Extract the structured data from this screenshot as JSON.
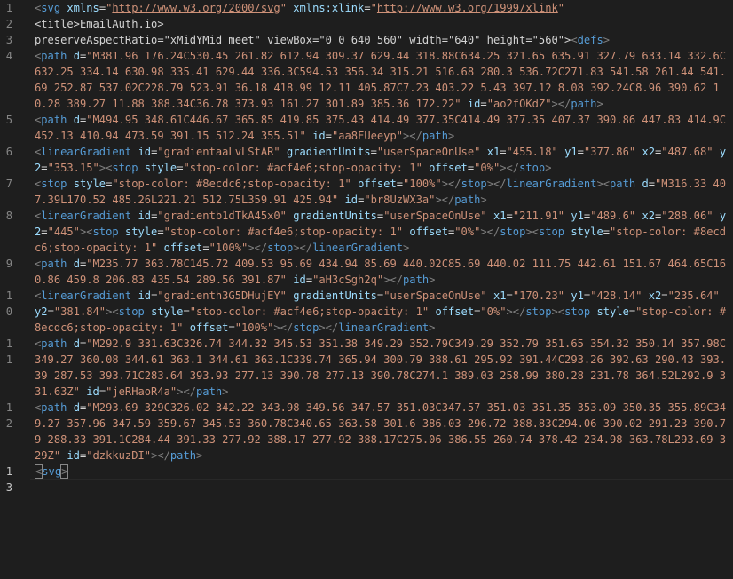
{
  "editor": {
    "language": "svg",
    "current_line": 13,
    "lines": [
      {
        "n": 1,
        "tokens": [
          [
            "brk",
            "<"
          ],
          [
            "tag",
            "svg"
          ],
          [
            "txt",
            " "
          ],
          [
            "attr",
            "xmlns"
          ],
          [
            "eq",
            "="
          ],
          [
            "str",
            "\""
          ],
          [
            "url",
            "http://www.w3.org/2000/svg"
          ],
          [
            "str",
            "\""
          ],
          [
            "txt",
            " "
          ],
          [
            "attr",
            "xmlns:xlink"
          ],
          [
            "eq",
            "="
          ],
          [
            "str",
            "\""
          ],
          [
            "url",
            "http://www.w3.org/1999/xlink"
          ],
          [
            "str",
            "\""
          ]
        ]
      },
      {
        "n": 2,
        "tokens": [
          [
            "txt",
            "<title>EmailAuth.io>"
          ]
        ]
      },
      {
        "n": 3,
        "tokens": [
          [
            "txt",
            "preserveAspectRatio=\"xMidYMid meet\" viewBox=\"0 0 640 560\" width=\"640\" height=\"560\">"
          ],
          [
            "brk",
            "<"
          ],
          [
            "tag",
            "defs"
          ],
          [
            "brk",
            ">"
          ]
        ]
      },
      {
        "n": 4,
        "tokens": [
          [
            "brk",
            "<"
          ],
          [
            "tag",
            "path"
          ],
          [
            "txt",
            " "
          ],
          [
            "attr",
            "d"
          ],
          [
            "eq",
            "="
          ],
          [
            "str",
            "\"M381.96 176.24C530.45 261.82 612.94 309.37 629.44 318.88C634.25 321.65 635.91 327.79 633.14 332.6C632.25 334.14 630.98 335.41 629.44 336.3C594.53 356.34 315.21 516.68 280.3 536.72C271.83 541.58 261.44 541.69 252.87 537.02C228.79 523.91 36.18 418.99 12.11 405.87C7.23 403.22 5.43 397.12 8.08 392.24C8.96 390.62 10.28 389.27 11.88 388.34C36.78 373.93 161.27 301.89 385.36 172.22\""
          ],
          [
            "txt",
            " "
          ],
          [
            "attr",
            "id"
          ],
          [
            "eq",
            "="
          ],
          [
            "str",
            "\"ao2fOKdZ\""
          ],
          [
            "brk",
            "></"
          ],
          [
            "tag",
            "path"
          ],
          [
            "brk",
            ">"
          ]
        ]
      },
      {
        "n": 5,
        "tokens": [
          [
            "brk",
            "<"
          ],
          [
            "tag",
            "path"
          ],
          [
            "txt",
            " "
          ],
          [
            "attr",
            "d"
          ],
          [
            "eq",
            "="
          ],
          [
            "str",
            "\"M494.95 348.61C446.67 365.85 419.85 375.43 414.49 377.35C414.49 377.35 407.37 390.86 447.83 414.9C452.13 410.94 473.59 391.15 512.24 355.51\""
          ],
          [
            "txt",
            " "
          ],
          [
            "attr",
            "id"
          ],
          [
            "eq",
            "="
          ],
          [
            "str",
            "\"aa8FUeeyp\""
          ],
          [
            "brk",
            "></"
          ],
          [
            "tag",
            "path"
          ],
          [
            "brk",
            ">"
          ]
        ]
      },
      {
        "n": 6,
        "tokens": [
          [
            "brk",
            "<"
          ],
          [
            "tag",
            "linearGradient"
          ],
          [
            "txt",
            " "
          ],
          [
            "attr",
            "id"
          ],
          [
            "eq",
            "="
          ],
          [
            "str",
            "\"gradientaaLvLStAR\""
          ],
          [
            "txt",
            " "
          ],
          [
            "attr",
            "gradientUnits"
          ],
          [
            "eq",
            "="
          ],
          [
            "str",
            "\"userSpaceOnUse\""
          ],
          [
            "txt",
            " "
          ],
          [
            "attr",
            "x1"
          ],
          [
            "eq",
            "="
          ],
          [
            "str",
            "\"455.18\""
          ],
          [
            "txt",
            " "
          ],
          [
            "attr",
            "y1"
          ],
          [
            "eq",
            "="
          ],
          [
            "str",
            "\"377.86\""
          ],
          [
            "txt",
            " "
          ],
          [
            "attr",
            "x2"
          ],
          [
            "eq",
            "="
          ],
          [
            "str",
            "\"487.68\""
          ],
          [
            "txt",
            " "
          ],
          [
            "attr",
            "y2"
          ],
          [
            "eq",
            "="
          ],
          [
            "str",
            "\"353.15\""
          ],
          [
            "brk",
            "><"
          ],
          [
            "tag",
            "stop"
          ],
          [
            "txt",
            " "
          ],
          [
            "attr",
            "style"
          ],
          [
            "eq",
            "="
          ],
          [
            "str",
            "\"stop-color: #acf4e6;stop-opacity: 1\""
          ],
          [
            "txt",
            " "
          ],
          [
            "attr",
            "offset"
          ],
          [
            "eq",
            "="
          ],
          [
            "str",
            "\"0%\""
          ],
          [
            "brk",
            "></"
          ],
          [
            "tag",
            "stop"
          ],
          [
            "brk",
            ">"
          ]
        ]
      },
      {
        "n": 7,
        "tokens": [
          [
            "brk",
            "<"
          ],
          [
            "tag",
            "stop"
          ],
          [
            "txt",
            " "
          ],
          [
            "attr",
            "style"
          ],
          [
            "eq",
            "="
          ],
          [
            "str",
            "\"stop-color: #8ecdc6;stop-opacity: 1\""
          ],
          [
            "txt",
            " "
          ],
          [
            "attr",
            "offset"
          ],
          [
            "eq",
            "="
          ],
          [
            "str",
            "\"100%\""
          ],
          [
            "brk",
            "></"
          ],
          [
            "tag",
            "stop"
          ],
          [
            "brk",
            "></"
          ],
          [
            "tag",
            "linearGradient"
          ],
          [
            "brk",
            "><"
          ],
          [
            "tag",
            "path"
          ],
          [
            "txt",
            " "
          ],
          [
            "attr",
            "d"
          ],
          [
            "eq",
            "="
          ],
          [
            "str",
            "\"M316.33 407.39L170.52 485.26L221.21 512.75L359.91 425.94\""
          ],
          [
            "txt",
            " "
          ],
          [
            "attr",
            "id"
          ],
          [
            "eq",
            "="
          ],
          [
            "str",
            "\"br8UzWX3a\""
          ],
          [
            "brk",
            "></"
          ],
          [
            "tag",
            "path"
          ],
          [
            "brk",
            ">"
          ]
        ]
      },
      {
        "n": 8,
        "tokens": [
          [
            "brk",
            "<"
          ],
          [
            "tag",
            "linearGradient"
          ],
          [
            "txt",
            " "
          ],
          [
            "attr",
            "id"
          ],
          [
            "eq",
            "="
          ],
          [
            "str",
            "\"gradientb1dTkA45x0\""
          ],
          [
            "txt",
            " "
          ],
          [
            "attr",
            "gradientUnits"
          ],
          [
            "eq",
            "="
          ],
          [
            "str",
            "\"userSpaceOnUse\""
          ],
          [
            "txt",
            " "
          ],
          [
            "attr",
            "x1"
          ],
          [
            "eq",
            "="
          ],
          [
            "str",
            "\"211.91\""
          ],
          [
            "txt",
            " "
          ],
          [
            "attr",
            "y1"
          ],
          [
            "eq",
            "="
          ],
          [
            "str",
            "\"489.6\""
          ],
          [
            "txt",
            " "
          ],
          [
            "attr",
            "x2"
          ],
          [
            "eq",
            "="
          ],
          [
            "str",
            "\"288.06\""
          ],
          [
            "txt",
            " "
          ],
          [
            "attr",
            "y2"
          ],
          [
            "eq",
            "="
          ],
          [
            "str",
            "\"445\""
          ],
          [
            "brk",
            "><"
          ],
          [
            "tag",
            "stop"
          ],
          [
            "txt",
            " "
          ],
          [
            "attr",
            "style"
          ],
          [
            "eq",
            "="
          ],
          [
            "str",
            "\"stop-color: #acf4e6;stop-opacity: 1\""
          ],
          [
            "txt",
            " "
          ],
          [
            "attr",
            "offset"
          ],
          [
            "eq",
            "="
          ],
          [
            "str",
            "\"0%\""
          ],
          [
            "brk",
            "></"
          ],
          [
            "tag",
            "stop"
          ],
          [
            "brk",
            "><"
          ],
          [
            "tag",
            "stop"
          ],
          [
            "txt",
            " "
          ],
          [
            "attr",
            "style"
          ],
          [
            "eq",
            "="
          ],
          [
            "str",
            "\"stop-color: #8ecdc6;stop-opacity: 1\""
          ],
          [
            "txt",
            " "
          ],
          [
            "attr",
            "offset"
          ],
          [
            "eq",
            "="
          ],
          [
            "str",
            "\"100%\""
          ],
          [
            "brk",
            "></"
          ],
          [
            "tag",
            "stop"
          ],
          [
            "brk",
            "></"
          ],
          [
            "tag",
            "linearGradient"
          ],
          [
            "brk",
            ">"
          ]
        ]
      },
      {
        "n": 9,
        "tokens": [
          [
            "brk",
            "<"
          ],
          [
            "tag",
            "path"
          ],
          [
            "txt",
            " "
          ],
          [
            "attr",
            "d"
          ],
          [
            "eq",
            "="
          ],
          [
            "str",
            "\"M235.77 363.78C145.72 409.53 95.69 434.94 85.69 440.02C85.69 440.02 111.75 442.61 151.67 464.65C160.86 459.8 206.83 435.54 289.56 391.87\""
          ],
          [
            "txt",
            " "
          ],
          [
            "attr",
            "id"
          ],
          [
            "eq",
            "="
          ],
          [
            "str",
            "\"aH3cSgh2q\""
          ],
          [
            "brk",
            "></"
          ],
          [
            "tag",
            "path"
          ],
          [
            "brk",
            ">"
          ]
        ]
      },
      {
        "n": 10,
        "tokens": [
          [
            "brk",
            "<"
          ],
          [
            "tag",
            "linearGradient"
          ],
          [
            "txt",
            " "
          ],
          [
            "attr",
            "id"
          ],
          [
            "eq",
            "="
          ],
          [
            "str",
            "\"gradienth3G5DHujEY\""
          ],
          [
            "txt",
            " "
          ],
          [
            "attr",
            "gradientUnits"
          ],
          [
            "eq",
            "="
          ],
          [
            "str",
            "\"userSpaceOnUse\""
          ],
          [
            "txt",
            " "
          ],
          [
            "attr",
            "x1"
          ],
          [
            "eq",
            "="
          ],
          [
            "str",
            "\"170.23\""
          ],
          [
            "txt",
            " "
          ],
          [
            "attr",
            "y1"
          ],
          [
            "eq",
            "="
          ],
          [
            "str",
            "\"428.14\""
          ],
          [
            "txt",
            " "
          ],
          [
            "attr",
            "x2"
          ],
          [
            "eq",
            "="
          ],
          [
            "str",
            "\"235.64\""
          ],
          [
            "txt",
            " "
          ],
          [
            "attr",
            "y2"
          ],
          [
            "eq",
            "="
          ],
          [
            "str",
            "\"381.84\""
          ],
          [
            "brk",
            "><"
          ],
          [
            "tag",
            "stop"
          ],
          [
            "txt",
            " "
          ],
          [
            "attr",
            "style"
          ],
          [
            "eq",
            "="
          ],
          [
            "str",
            "\"stop-color: #acf4e6;stop-opacity: 1\""
          ],
          [
            "txt",
            " "
          ],
          [
            "attr",
            "offset"
          ],
          [
            "eq",
            "="
          ],
          [
            "str",
            "\"0%\""
          ],
          [
            "brk",
            "></"
          ],
          [
            "tag",
            "stop"
          ],
          [
            "brk",
            "><"
          ],
          [
            "tag",
            "stop"
          ],
          [
            "txt",
            " "
          ],
          [
            "attr",
            "style"
          ],
          [
            "eq",
            "="
          ],
          [
            "str",
            "\"stop-color: #8ecdc6;stop-opacity: 1\""
          ],
          [
            "txt",
            " "
          ],
          [
            "attr",
            "offset"
          ],
          [
            "eq",
            "="
          ],
          [
            "str",
            "\"100%\""
          ],
          [
            "brk",
            "></"
          ],
          [
            "tag",
            "stop"
          ],
          [
            "brk",
            "></"
          ],
          [
            "tag",
            "linearGradient"
          ],
          [
            "brk",
            ">"
          ]
        ]
      },
      {
        "n": 11,
        "tokens": [
          [
            "brk",
            "<"
          ],
          [
            "tag",
            "path"
          ],
          [
            "txt",
            " "
          ],
          [
            "attr",
            "d"
          ],
          [
            "eq",
            "="
          ],
          [
            "str",
            "\"M292.9 331.63C326.74 344.32 345.53 351.38 349.29 352.79C349.29 352.79 351.65 354.32 350.14 357.98C349.27 360.08 344.61 363.1 344.61 363.1C339.74 365.94 300.79 388.61 295.92 391.44C293.26 392.63 290.43 393.39 287.53 393.71C283.64 393.93 277.13 390.78 277.13 390.78C274.1 389.03 258.99 380.28 231.78 364.52L292.9 331.63Z\""
          ],
          [
            "txt",
            " "
          ],
          [
            "attr",
            "id"
          ],
          [
            "eq",
            "="
          ],
          [
            "str",
            "\"jeRHaoR4a\""
          ],
          [
            "brk",
            "></"
          ],
          [
            "tag",
            "path"
          ],
          [
            "brk",
            ">"
          ]
        ]
      },
      {
        "n": 12,
        "tokens": [
          [
            "brk",
            "<"
          ],
          [
            "tag",
            "path"
          ],
          [
            "txt",
            " "
          ],
          [
            "attr",
            "d"
          ],
          [
            "eq",
            "="
          ],
          [
            "str",
            "\"M293.69 329C326.02 342.22 343.98 349.56 347.57 351.03C347.57 351.03 351.35 353.09 350.35 355.89C349.27 357.96 347.59 359.67 345.53 360.78C340.65 363.58 301.6 386.03 296.72 388.83C294.06 390.02 291.23 390.79 288.33 391.1C284.44 391.33 277.92 388.17 277.92 388.17C275.06 386.55 260.74 378.42 234.98 363.78L293.69 329Z\""
          ],
          [
            "txt",
            " "
          ],
          [
            "attr",
            "id"
          ],
          [
            "eq",
            "="
          ],
          [
            "str",
            "\"dzkkuzDI\""
          ],
          [
            "brk",
            "></"
          ],
          [
            "tag",
            "path"
          ],
          [
            "brk",
            ">"
          ]
        ]
      },
      {
        "n": 13,
        "tokens": [
          [
            "brk",
            "<"
          ],
          [
            "tag",
            "svg"
          ],
          [
            "brk",
            ">"
          ]
        ]
      }
    ]
  }
}
